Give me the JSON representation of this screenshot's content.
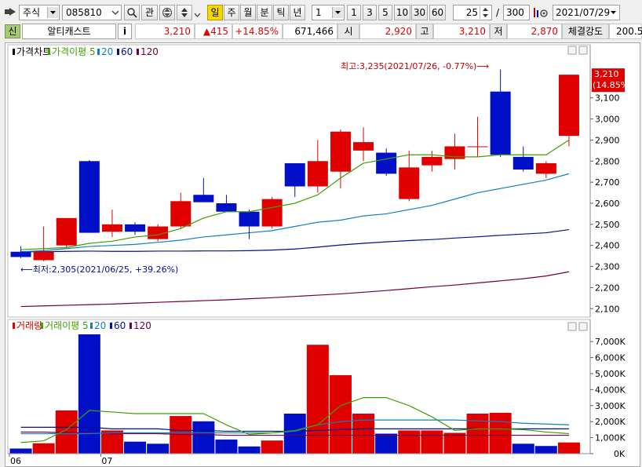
{
  "toolbar": {
    "market": "주식",
    "code": "085810",
    "btn_gwan": "관",
    "periods": [
      "일",
      "주",
      "월",
      "분",
      "틱",
      "년"
    ],
    "active_period": "일",
    "interval_value": "1",
    "intervals": [
      "1",
      "3",
      "5",
      "10",
      "30",
      "60"
    ],
    "count": "25",
    "slash": "/",
    "total": "300",
    "date": "2021/07/29"
  },
  "quote": {
    "tag": "신",
    "name": "알티캐스트",
    "info": "i",
    "price": "3,210",
    "change": "▲415",
    "pct": "+14.85%",
    "volume": "671,466",
    "open_label": "시",
    "open": "2,920",
    "high_label": "고",
    "high": "3,210",
    "low_label": "저",
    "low": "2,870",
    "strength_label": "체결강도",
    "strength": "200.5"
  },
  "colors": {
    "up": "#e00000",
    "down": "#0010c8",
    "ma5": "#40a000",
    "ma20": "#1080c0",
    "ma60": "#001090",
    "ma120": "#700040"
  },
  "chart_data": [
    {
      "type": "candlestick",
      "legend": [
        {
          "label": "가격차트",
          "icon": "legend-square"
        },
        {
          "label": "가격이평 5",
          "icon": "legend-square"
        },
        {
          "label": "20",
          "icon": "legend-square"
        },
        {
          "label": "60",
          "icon": "legend-square"
        },
        {
          "label": "120",
          "icon": "legend-square"
        }
      ],
      "ylim": [
        2060,
        3300
      ],
      "y_ticks": [
        2100,
        2200,
        2300,
        2400,
        2500,
        2600,
        2700,
        2800,
        2900,
        3000,
        3100
      ],
      "y_tick_labels": [
        "2,100",
        "2,200",
        "2,300",
        "2,400",
        "2,500",
        "2,600",
        "2,700",
        "2,800",
        "2,900",
        "3,000",
        "3,100"
      ],
      "last_price_label": "3,210",
      "last_pct_label": "(14.85%)",
      "high_annotation": "최고:3,235(2021/07/26, -0.77%)⟶",
      "low_annotation": "⟵최저:2,305(2021/06/25, +39.26%)",
      "candles": [
        {
          "o": 2370,
          "h": 2395,
          "l": 2340,
          "c": 2345
        },
        {
          "o": 2330,
          "h": 2490,
          "l": 2325,
          "c": 2370
        },
        {
          "o": 2400,
          "h": 2480,
          "l": 2390,
          "c": 2530
        },
        {
          "o": 2800,
          "h": 2805,
          "l": 2460,
          "c": 2460
        },
        {
          "o": 2465,
          "h": 2570,
          "l": 2440,
          "c": 2500
        },
        {
          "o": 2500,
          "h": 2510,
          "l": 2450,
          "c": 2465
        },
        {
          "o": 2430,
          "h": 2500,
          "l": 2420,
          "c": 2490
        },
        {
          "o": 2490,
          "h": 2650,
          "l": 2480,
          "c": 2610
        },
        {
          "o": 2640,
          "h": 2720,
          "l": 2620,
          "c": 2605
        },
        {
          "o": 2600,
          "h": 2640,
          "l": 2560,
          "c": 2560
        },
        {
          "o": 2560,
          "h": 2570,
          "l": 2430,
          "c": 2490
        },
        {
          "o": 2490,
          "h": 2630,
          "l": 2480,
          "c": 2620
        },
        {
          "o": 2790,
          "h": 2790,
          "l": 2630,
          "c": 2680
        },
        {
          "o": 2680,
          "h": 2900,
          "l": 2650,
          "c": 2800
        },
        {
          "o": 2750,
          "h": 2950,
          "l": 2670,
          "c": 2940
        },
        {
          "o": 2850,
          "h": 2960,
          "l": 2800,
          "c": 2890
        },
        {
          "o": 2840,
          "h": 2860,
          "l": 2730,
          "c": 2740
        },
        {
          "o": 2620,
          "h": 2850,
          "l": 2610,
          "c": 2770
        },
        {
          "o": 2780,
          "h": 2850,
          "l": 2750,
          "c": 2820
        },
        {
          "o": 2810,
          "h": 2930,
          "l": 2760,
          "c": 2870
        },
        {
          "o": 2870,
          "h": 3010,
          "l": 2820,
          "c": 2870
        },
        {
          "o": 3130,
          "h": 3235,
          "l": 2820,
          "c": 2830
        },
        {
          "o": 2820,
          "h": 2870,
          "l": 2750,
          "c": 2760
        },
        {
          "o": 2740,
          "h": 2800,
          "l": 2720,
          "c": 2790
        },
        {
          "o": 2920,
          "h": 3210,
          "l": 2870,
          "c": 3210
        }
      ],
      "ma5": [
        2380,
        2385,
        2390,
        2410,
        2420,
        2440,
        2450,
        2480,
        2530,
        2560,
        2560,
        2580,
        2600,
        2640,
        2720,
        2790,
        2810,
        2830,
        2830,
        2820,
        2820,
        2830,
        2830,
        2830,
        2900
      ],
      "ma20": [
        2370,
        2375,
        2385,
        2395,
        2400,
        2405,
        2415,
        2425,
        2440,
        2450,
        2460,
        2470,
        2490,
        2510,
        2520,
        2540,
        2550,
        2570,
        2590,
        2620,
        2650,
        2670,
        2690,
        2710,
        2740
      ],
      "ma60": [
        2370,
        2370,
        2372,
        2373,
        2372,
        2372,
        2373,
        2373,
        2374,
        2374,
        2375,
        2378,
        2383,
        2392,
        2402,
        2410,
        2417,
        2423,
        2428,
        2435,
        2441,
        2448,
        2454,
        2460,
        2475
      ],
      "ma120": [
        2110,
        2113,
        2116,
        2119,
        2122,
        2126,
        2130,
        2134,
        2138,
        2142,
        2147,
        2152,
        2158,
        2164,
        2170,
        2178,
        2186,
        2195,
        2204,
        2212,
        2222,
        2232,
        2242,
        2255,
        2275
      ]
    },
    {
      "type": "bar",
      "legend": [
        {
          "label": "거래량",
          "icon": "legend-square"
        },
        {
          "label": "거래이평 5",
          "icon": "legend-square"
        },
        {
          "label": "20",
          "icon": "legend-square"
        },
        {
          "label": "60",
          "icon": "legend-square"
        },
        {
          "label": "120",
          "icon": "legend-square"
        }
      ],
      "ylim": [
        0,
        7500000
      ],
      "y_ticks": [
        0,
        1000000,
        2000000,
        3000000,
        4000000,
        5000000,
        6000000,
        7000000
      ],
      "y_tick_labels": [
        "0K",
        "1,000K",
        "2,000K",
        "3,000K",
        "4,000K",
        "5,000K",
        "6,000K",
        "7,000K"
      ],
      "x_tick_labels": [
        {
          "index": 0,
          "label": "06"
        },
        {
          "index": 4,
          "label": "07"
        }
      ],
      "values": [
        320000,
        650000,
        2700000,
        7450000,
        1450000,
        750000,
        620000,
        2350000,
        2020000,
        880000,
        450000,
        820000,
        2500000,
        6800000,
        4900000,
        2500000,
        1250000,
        1450000,
        1450000,
        1300000,
        2500000,
        2550000,
        620000,
        480000,
        700000
      ],
      "up": [
        false,
        true,
        true,
        false,
        true,
        false,
        false,
        true,
        false,
        false,
        false,
        true,
        false,
        true,
        true,
        true,
        false,
        true,
        true,
        true,
        true,
        true,
        false,
        false,
        true
      ],
      "ma5": [
        700000,
        800000,
        1500000,
        2700000,
        2600000,
        2500000,
        2500000,
        2500000,
        2500000,
        1800000,
        1200000,
        1300000,
        1450000,
        1800000,
        3000000,
        3500000,
        3500000,
        3000000,
        2300000,
        1450000,
        1550000,
        1550000,
        1500000,
        1350000,
        1250000
      ],
      "ma20": [
        1250000,
        1250000,
        1250000,
        1250000,
        1300000,
        1300000,
        1300000,
        1300000,
        1300000,
        1300000,
        1300000,
        1300000,
        1400000,
        1800000,
        2000000,
        2100000,
        2100000,
        2100000,
        2100000,
        2100000,
        2050000,
        2000000,
        1900000,
        1850000,
        1800000
      ],
      "ma60": [
        1650000,
        1650000,
        1650000,
        1650000,
        1550000,
        1550000,
        1550000,
        1450000,
        1450000,
        1400000,
        1400000,
        1400000,
        1400000,
        1450000,
        1500000,
        1550000,
        1550000,
        1550000,
        1550000,
        1550000,
        1550000,
        1550000,
        1550000,
        1550000,
        1550000
      ],
      "ma120": [
        1350000,
        1350000,
        1300000,
        1300000,
        1250000,
        1250000,
        1250000,
        1200000,
        1200000,
        1150000,
        1150000,
        1150000,
        1150000,
        1150000,
        1150000,
        1150000,
        1150000,
        1150000,
        1150000,
        1150000,
        1150000,
        1150000,
        1150000,
        1150000,
        1150000
      ]
    }
  ]
}
